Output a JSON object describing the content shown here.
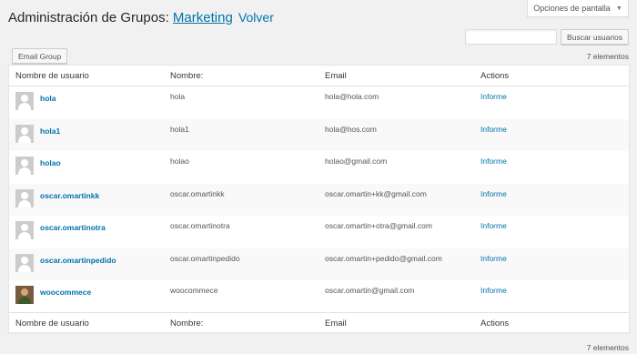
{
  "screen_options": {
    "label": "Opciones de pantalla",
    "arrow": "▼"
  },
  "header": {
    "title": "Administración de Grupos:",
    "group_name": "Marketing",
    "back_label": "Volver"
  },
  "search": {
    "value": "",
    "button_label": "Buscar usuarios"
  },
  "toolbar": {
    "email_group_label": "Email Group"
  },
  "counts": {
    "top": "7 elementos",
    "bottom": "7 elementos"
  },
  "table": {
    "columns": {
      "username": "Nombre de usuario",
      "name": "Nombre:",
      "email": "Email",
      "actions": "Actions"
    },
    "rows": [
      {
        "username": "hola",
        "name": "hola",
        "email": "hola@hola.com",
        "action": "Informe",
        "avatar": "default-avatar"
      },
      {
        "username": "hola1",
        "name": "hola1",
        "email": "hola@hos.com",
        "action": "Informe",
        "avatar": "default-avatar"
      },
      {
        "username": "holao",
        "name": "holao",
        "email": "holao@gmail.com",
        "action": "Informe",
        "avatar": "default-avatar"
      },
      {
        "username": "oscar.omartinkk",
        "name": "oscar.omartinkk",
        "email": "oscar.omartin+kk@gmail.com",
        "action": "Informe",
        "avatar": "default-avatar"
      },
      {
        "username": "oscar.omartinotra",
        "name": "oscar.omartinotra",
        "email": "oscar.omartin+otra@gmail.com",
        "action": "Informe",
        "avatar": "default-avatar"
      },
      {
        "username": "oscar.omartinpedido",
        "name": "oscar.omartinpedido",
        "email": "oscar.omartin+pedido@gmail.com",
        "action": "Informe",
        "avatar": "default-avatar"
      },
      {
        "username": "woocommece",
        "name": "woocommece",
        "email": "oscar.omartin@gmail.com",
        "action": "Informe",
        "avatar": "photo-avatar"
      }
    ]
  }
}
